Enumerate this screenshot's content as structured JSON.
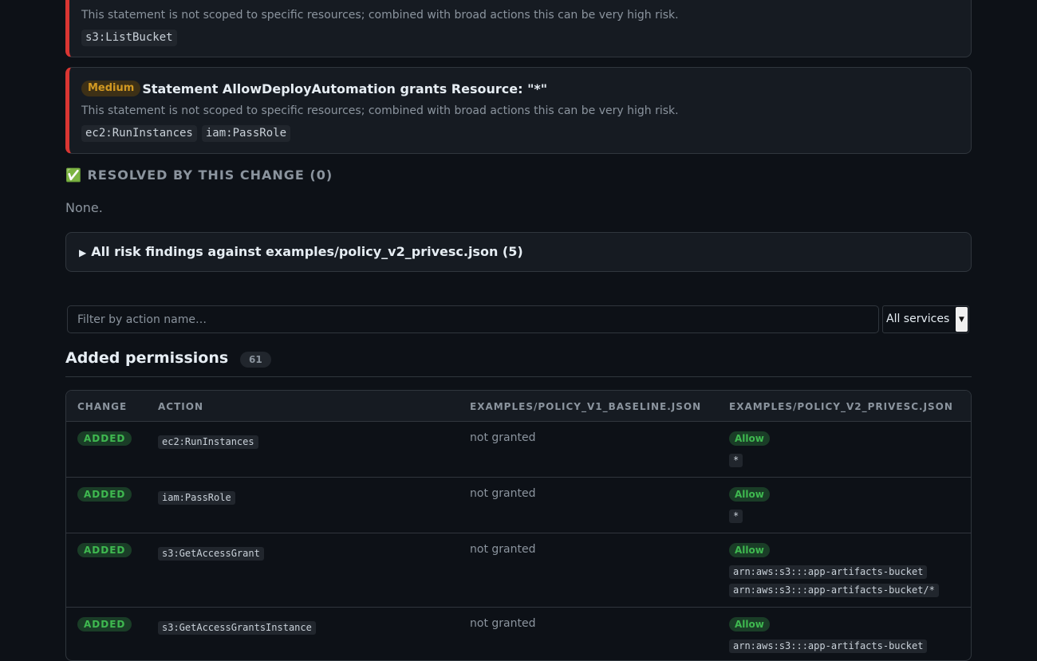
{
  "findings": [
    {
      "severity": "",
      "title": "",
      "description": "This statement is not scoped to specific resources; combined with broad actions this can be very high risk.",
      "actions": [
        "s3:ListBucket"
      ]
    },
    {
      "severity": "Medium",
      "title": "Statement AllowDeployAutomation grants Resource: \"*\"",
      "description": "This statement is not scoped to specific resources; combined with broad actions this can be very high risk.",
      "actions": [
        "ec2:RunInstances",
        "iam:PassRole"
      ]
    }
  ],
  "resolved": {
    "icon": "check-icon",
    "heading": "RESOLVED BY THIS CHANGE (0)",
    "none_text": "None."
  },
  "all_findings": {
    "summary": "All risk findings against examples/policy_v2_privesc.json (5)"
  },
  "filter": {
    "placeholder": "Filter by action name…",
    "service_select": "All services"
  },
  "added_permissions": {
    "heading": "Added permissions",
    "count": "61",
    "columns": [
      "CHANGE",
      "ACTION",
      "EXAMPLES/POLICY_V1_BASELINE.JSON",
      "EXAMPLES/POLICY_V2_PRIVESC.JSON"
    ],
    "rows": [
      {
        "change": "ADDED",
        "action": "ec2:RunInstances",
        "baseline": "not granted",
        "effect": "Allow",
        "resources": [
          "*"
        ]
      },
      {
        "change": "ADDED",
        "action": "iam:PassRole",
        "baseline": "not granted",
        "effect": "Allow",
        "resources": [
          "*"
        ]
      },
      {
        "change": "ADDED",
        "action": "s3:GetAccessGrant",
        "baseline": "not granted",
        "effect": "Allow",
        "resources": [
          "arn:aws:s3:::app-artifacts-bucket",
          "arn:aws:s3:::app-artifacts-bucket/*"
        ]
      },
      {
        "change": "ADDED",
        "action": "s3:GetAccessGrantsInstance",
        "baseline": "not granted",
        "effect": "Allow",
        "resources": [
          "arn:aws:s3:::app-artifacts-bucket"
        ]
      }
    ]
  },
  "colors": {
    "background": "#0d1117",
    "panel": "#161b22",
    "border": "#30363d",
    "high_risk_accent": "#da3633",
    "medium": "#d29922",
    "added_green": "#3fb950"
  }
}
